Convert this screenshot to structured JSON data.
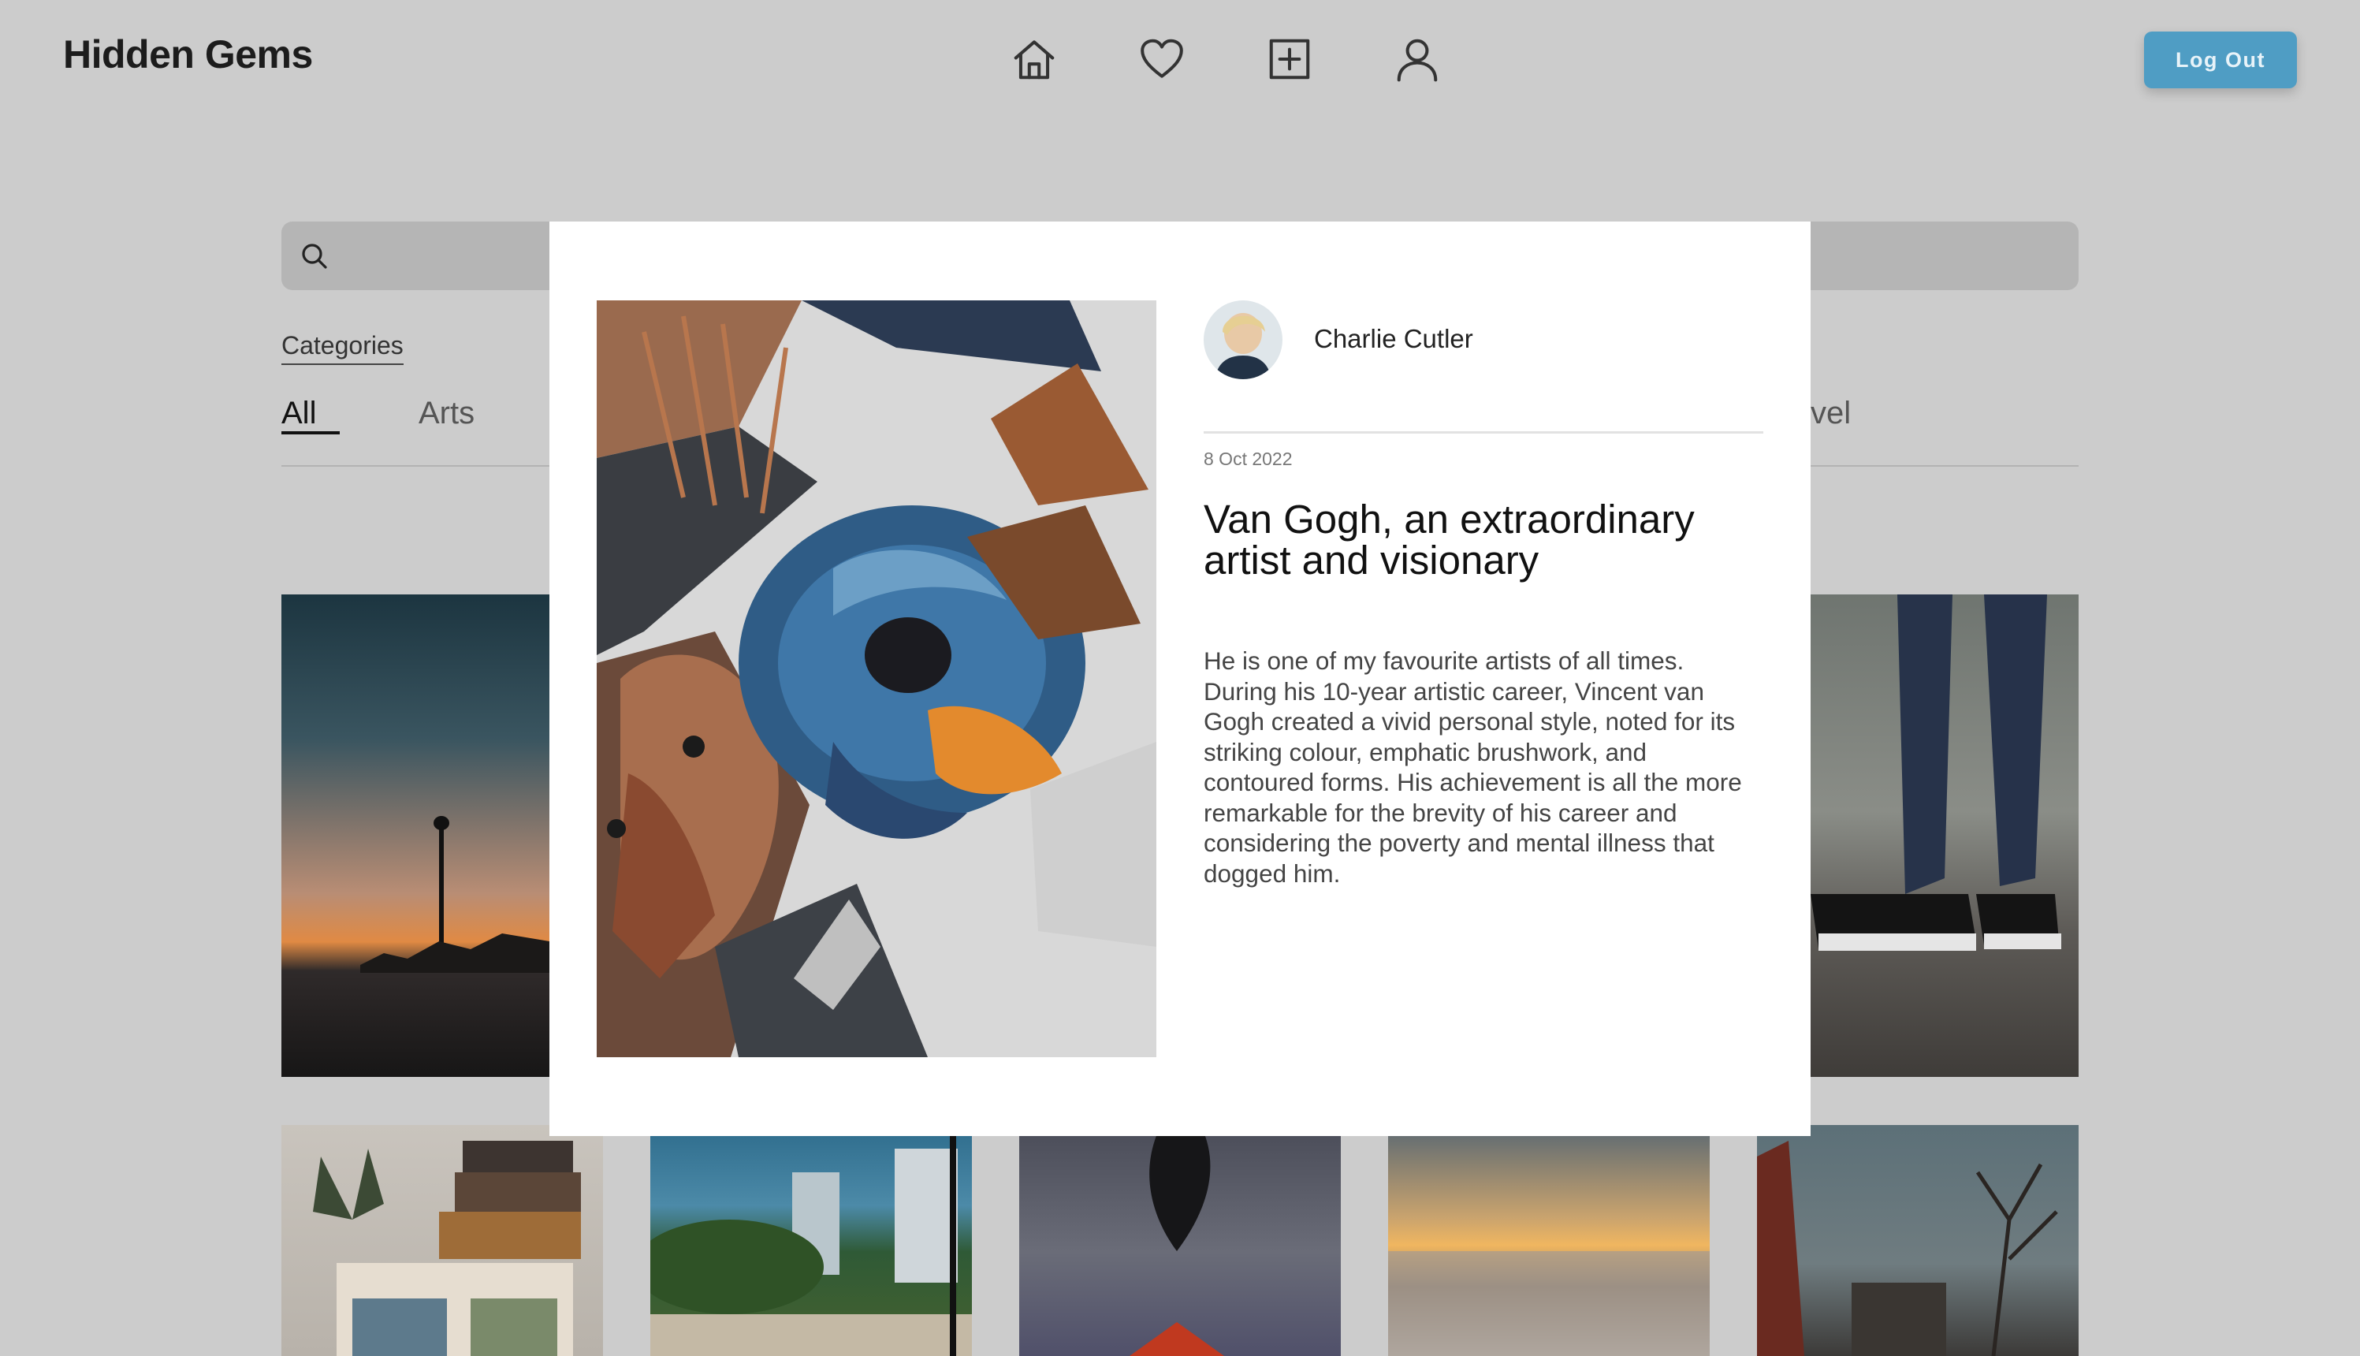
{
  "header": {
    "brand": "Hidden Gems",
    "nav_icons": [
      "home-icon",
      "heart-icon",
      "add-post-icon",
      "profile-icon"
    ],
    "logout_label": "Log Out"
  },
  "search": {
    "placeholder": "",
    "value": ""
  },
  "categories": {
    "title": "Categories",
    "tabs": [
      {
        "label": "All",
        "active": true
      },
      {
        "label": "Arts",
        "active": false
      },
      {
        "label": "vel",
        "active": false,
        "note_partial": true
      }
    ]
  },
  "modal": {
    "author": {
      "name": "Charlie Cutler"
    },
    "date": "8 Oct 2022",
    "title": "Van Gogh, an extraordinary artist and visionary",
    "body": "He is one of my favourite artists of all times. During his 10-year artistic career, Vincent van Gogh created a vivid personal style, noted for its striking colour, emphatic brushwork, and contoured forms. His achievement is all the more remarkable for the brevity of his career and considering the poverty and mental illness that dogged him."
  },
  "colors": {
    "page_bg": "#cccccc",
    "accent": "#4f9dc4",
    "modal_bg": "#ffffff"
  }
}
